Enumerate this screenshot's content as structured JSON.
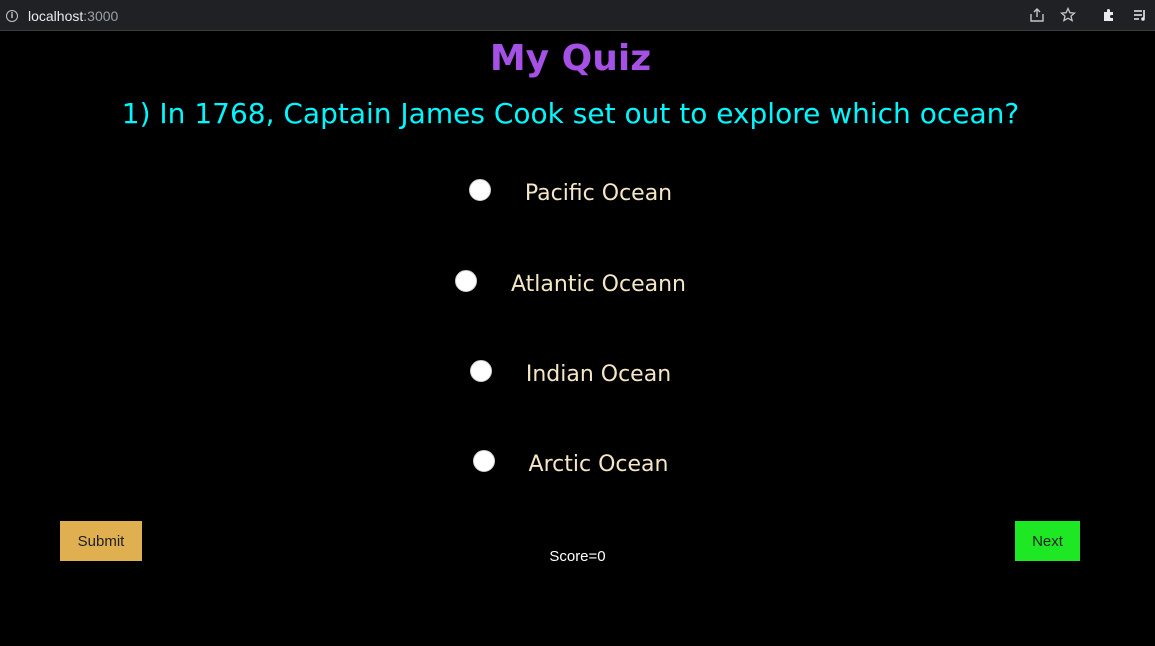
{
  "browser": {
    "url_host": "localhost",
    "url_port": ":3000",
    "icons": [
      "share-icon",
      "star-icon",
      "puzzle-icon",
      "reading-list-icon"
    ]
  },
  "quiz": {
    "title": "My Quiz",
    "question": "1) In 1768, Captain James Cook set out to explore which ocean?",
    "options": [
      {
        "label": "Pacific Ocean",
        "selected": false
      },
      {
        "label": "Atlantic Oceann",
        "selected": false
      },
      {
        "label": "Indian Ocean",
        "selected": false
      },
      {
        "label": "Arctic Ocean",
        "selected": false
      }
    ],
    "submit_label": "Submit",
    "next_label": "Next",
    "score_text": "Score=0"
  },
  "colors": {
    "title": "#a651e6",
    "question": "#00f7ff",
    "option_text": "#f5e6c4",
    "submit_bg": "#e0b050",
    "next_bg": "#1de823",
    "background": "#000000"
  }
}
